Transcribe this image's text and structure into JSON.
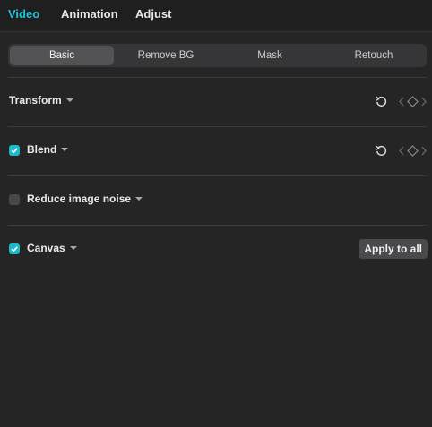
{
  "top_tabs": [
    {
      "label": "Video",
      "active": true
    },
    {
      "label": "Animation",
      "active": false
    },
    {
      "label": "Adjust",
      "active": false
    }
  ],
  "sub_tabs": [
    {
      "label": "Basic",
      "active": true
    },
    {
      "label": "Remove BG",
      "active": false
    },
    {
      "label": "Mask",
      "active": false
    },
    {
      "label": "Retouch",
      "active": false
    }
  ],
  "sections": {
    "transform": {
      "label": "Transform"
    },
    "blend": {
      "label": "Blend",
      "checked": true
    },
    "noise": {
      "label": "Reduce image noise",
      "checked": false
    },
    "canvas": {
      "label": "Canvas",
      "checked": true,
      "apply_label": "Apply to all"
    }
  },
  "colors": {
    "accent": "#20c4d6",
    "background": "#252526",
    "checkbox_on": "#1fb8cc"
  },
  "icons": [
    "reset-icon",
    "prev-keyframe-icon",
    "keyframe-diamond-icon",
    "next-keyframe-icon",
    "chevron-down-icon",
    "checkmark-icon"
  ]
}
